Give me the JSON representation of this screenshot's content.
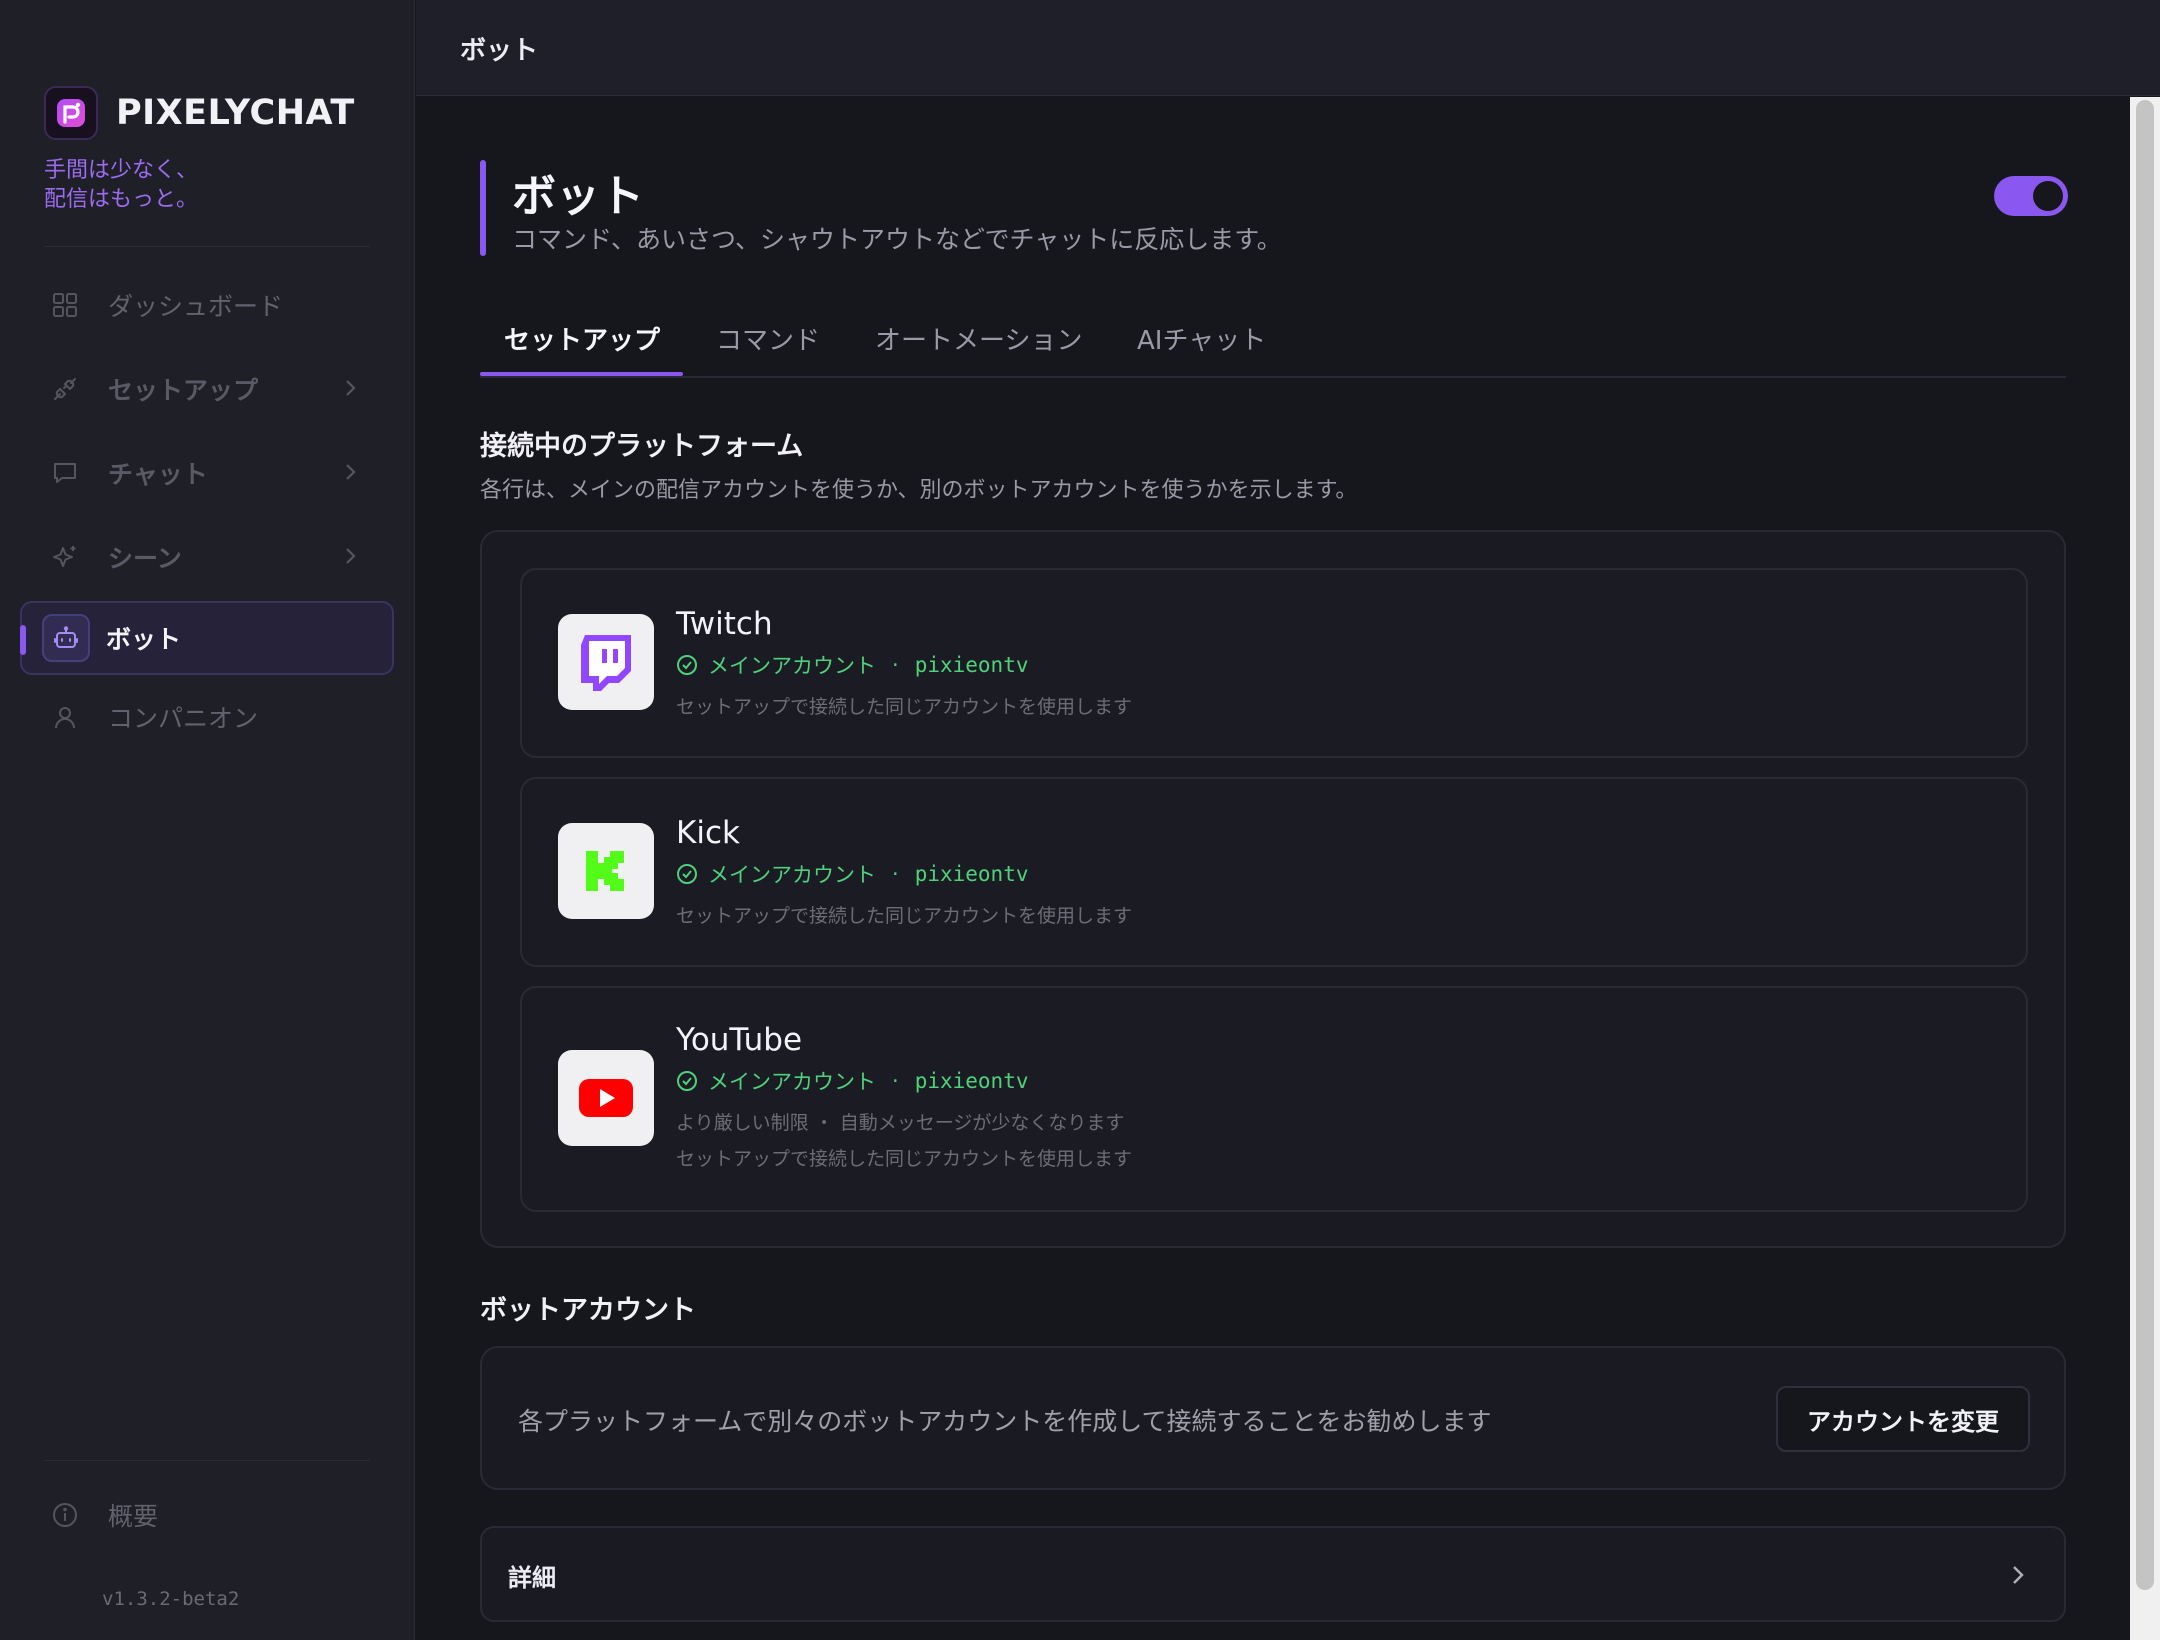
{
  "app": {
    "name": "PIXELYCHAT",
    "tagline_line1": "手間は少なく、",
    "tagline_line2": "配信はもっと。",
    "version": "v1.3.2-beta2",
    "accent_color": "#8a57f0"
  },
  "sidebar": {
    "items": [
      {
        "label": "ダッシュボード",
        "icon": "grid-icon"
      },
      {
        "label": "セットアップ",
        "icon": "plug-icon",
        "has_chevron": true
      },
      {
        "label": "チャット",
        "icon": "chat-icon",
        "has_chevron": true
      },
      {
        "label": "シーン",
        "icon": "sparkle-icon",
        "has_chevron": true
      },
      {
        "label": "ボット",
        "icon": "robot-icon",
        "active": true
      },
      {
        "label": "コンパニオン",
        "icon": "user-icon"
      }
    ],
    "footer_item": {
      "label": "概要",
      "icon": "info-icon"
    }
  },
  "topbar": {
    "title": "ボット"
  },
  "page": {
    "title": "ボット",
    "subtitle": "コマンド、あいさつ、シャウトアウトなどでチャットに反応します。",
    "enabled": true
  },
  "tabs": [
    {
      "label": "セットアップ",
      "active": true
    },
    {
      "label": "コマンド"
    },
    {
      "label": "オートメーション"
    },
    {
      "label": "AIチャット"
    }
  ],
  "platforms_section": {
    "title": "接続中のプラットフォーム",
    "description": "各行は、メインの配信アカウントを使うか、別のボットアカウントを使うかを示します。",
    "platforms": [
      {
        "name": "Twitch",
        "account_type": "メインアカウント",
        "sep": "·",
        "username": "pixieontv",
        "note": "セットアップで接続した同じアカウントを使用します",
        "icon": "twitch-icon"
      },
      {
        "name": "Kick",
        "account_type": "メインアカウント",
        "sep": "·",
        "username": "pixieontv",
        "note": "セットアップで接続した同じアカウントを使用します",
        "icon": "kick-icon"
      },
      {
        "name": "YouTube",
        "account_type": "メインアカウント",
        "sep": "·",
        "username": "pixieontv",
        "warning": "より厳しい制限 ・ 自動メッセージが少なくなります",
        "note": "セットアップで接続した同じアカウントを使用します",
        "icon": "youtube-icon"
      }
    ]
  },
  "bot_account": {
    "title": "ボットアカウント",
    "text": "各プラットフォームで別々のボットアカウントを作成して接続することをお勧めします",
    "button": "アカウントを変更"
  },
  "details": {
    "label": "詳細"
  }
}
